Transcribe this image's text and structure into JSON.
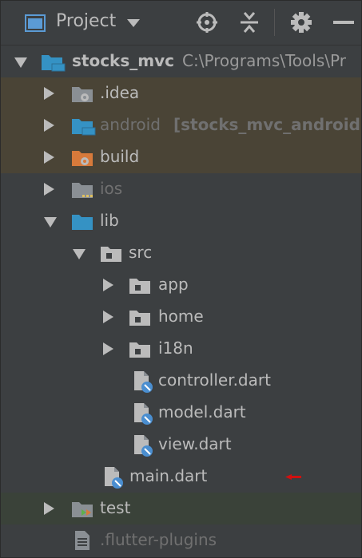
{
  "header": {
    "title": "Project",
    "icons": [
      "window-icon",
      "dropdown-arrow-icon",
      "locate-icon",
      "collapse-all-icon",
      "gear-icon",
      "hide-icon"
    ]
  },
  "tree": {
    "root": {
      "name": "stocks_mvc",
      "path": "C:\\Programs\\Tools\\Pr"
    },
    "idea": {
      "name": ".idea"
    },
    "android": {
      "name": "android",
      "module": "[stocks_mvc_android]"
    },
    "build": {
      "name": "build"
    },
    "ios": {
      "name": "ios"
    },
    "lib": {
      "name": "lib"
    },
    "src": {
      "name": "src"
    },
    "app": {
      "name": "app"
    },
    "home": {
      "name": "home"
    },
    "i18n": {
      "name": "i18n"
    },
    "controller": {
      "name": "controller.dart"
    },
    "model": {
      "name": "model.dart"
    },
    "view": {
      "name": "view.dart"
    },
    "main": {
      "name": "main.dart"
    },
    "test": {
      "name": "test"
    },
    "flutter_plugins": {
      "name": ".flutter-plugins"
    }
  },
  "colors": {
    "background": "#3c3f41",
    "text": "#bbbbbb",
    "excluded_text": "#707070",
    "folder_blue": "#3592c4",
    "highlight_excluded": "#4a4436",
    "highlight_test": "#3a4239",
    "arrow_red": "#d01010"
  }
}
